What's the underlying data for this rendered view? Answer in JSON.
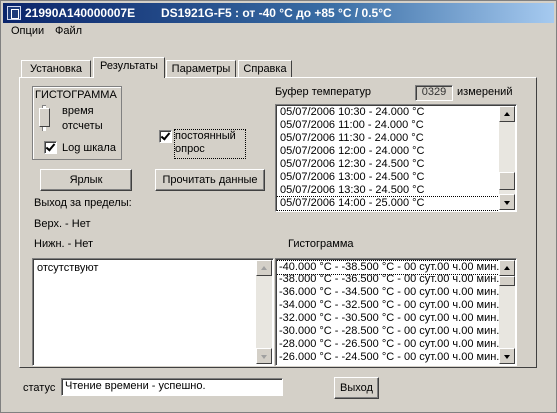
{
  "window": {
    "title_id": "21990A140000007E",
    "title_desc": "DS1921G-F5 : от -40 °C до +85 °C / 0.5°C"
  },
  "menu": [
    "Опции",
    "Файл"
  ],
  "tabs": [
    "Установка",
    "Результаты",
    "Параметры",
    "Справка"
  ],
  "active_tab": 1,
  "histogram_group": {
    "title": "ГИСТОГРАММА",
    "option_time": "время",
    "option_counts": "отсчеты",
    "log_scale_label": "Log шкала",
    "log_scale_checked": true
  },
  "poll": {
    "label_line1": "постоянный",
    "label_line2": "опрос",
    "checked": true
  },
  "buttons": {
    "label": "Ярлык",
    "read": "Прочитать данные",
    "exit": "Выход"
  },
  "limits": {
    "title": "Выход за пределы:",
    "upper": "Верх.  - Нет",
    "lower": "Нижн. - Нет",
    "list": [
      "отсутствуют"
    ]
  },
  "buffer": {
    "title": "Буфер температур",
    "count": "0329",
    "count_suffix": "измерений",
    "items": [
      "05/07/2006 10:30 -  24.000 °C",
      "05/07/2006 11:00 -  24.000 °C",
      "05/07/2006 11:30 -  24.000 °C",
      "05/07/2006 12:00 -  24.000 °C",
      "05/07/2006 12:30 -  24.500 °C",
      "05/07/2006 13:00 -  24.500 °C",
      "05/07/2006 13:30 -  24.500 °C",
      "05/07/2006 14:00 -  25.000 °C"
    ]
  },
  "histogram": {
    "title": "Гистограмма",
    "items": [
      "-40.000 °C - -38.500 °C - 00 сут.00 ч.00 мин.",
      "-38.000 °C - -36.500 °C - 00 сут.00 ч.00 мин.",
      "-36.000 °C - -34.500 °C - 00 сут.00 ч.00 мин.",
      "-34.000 °C - -32.500 °C - 00 сут.00 ч.00 мин.",
      "-32.000 °C - -30.500 °C - 00 сут.00 ч.00 мин.",
      "-30.000 °C - -28.500 °C - 00 сут.00 ч.00 мин.",
      "-28.000 °C - -26.500 °C - 00 сут.00 ч.00 мин.",
      "-26.000 °C - -24.500 °C - 00 сут.00 ч.00 мин."
    ]
  },
  "status": {
    "label": "статус",
    "text": "Чтение времени - успешно."
  }
}
